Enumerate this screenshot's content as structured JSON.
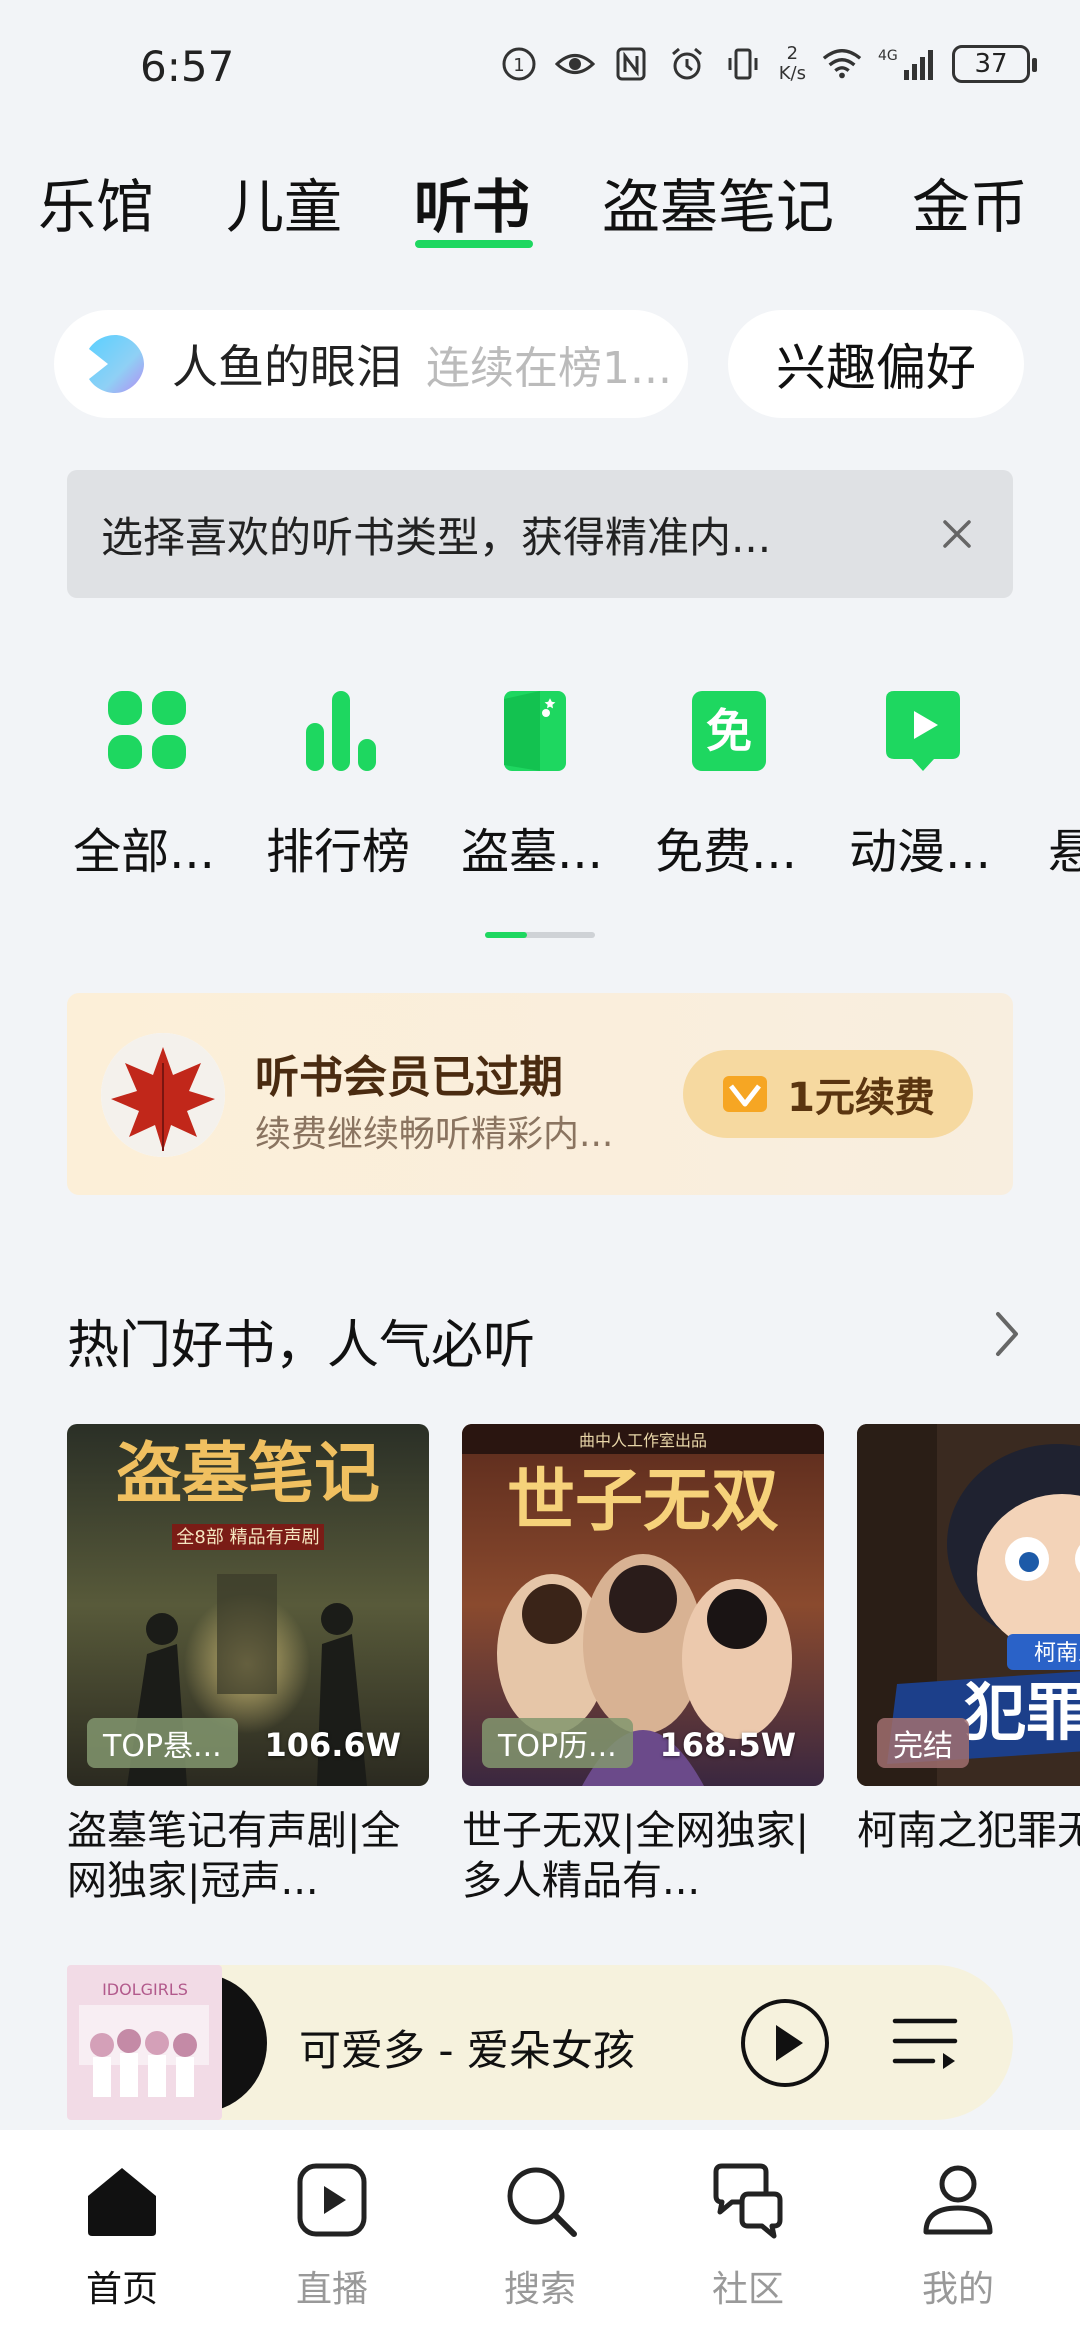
{
  "status_bar": {
    "time": "6:57",
    "net_speed_top": "2",
    "net_speed_bottom": "K/s",
    "network": "4G",
    "battery": "37"
  },
  "top_tabs": [
    {
      "label": "乐馆",
      "active": false
    },
    {
      "label": "儿童",
      "active": false
    },
    {
      "label": "听书",
      "active": true
    },
    {
      "label": "盗墓笔记",
      "active": false
    },
    {
      "label": "金币",
      "active": false
    }
  ],
  "search": {
    "term": "人鱼的眼泪",
    "hint": "连续在榜1..."
  },
  "preference_button": "兴趣偏好",
  "notice": {
    "text": "选择喜欢的听书类型，获得精准内..."
  },
  "categories": [
    {
      "label": "全部...",
      "icon": "grid-icon"
    },
    {
      "label": "排行榜",
      "icon": "bar-chart-icon"
    },
    {
      "label": "盗墓...",
      "icon": "door-icon"
    },
    {
      "label": "免费...",
      "icon": "free-icon"
    },
    {
      "label": "动漫...",
      "icon": "video-icon"
    },
    {
      "label": "悬",
      "icon": "partial-icon"
    }
  ],
  "category_scroll_position": 0.0,
  "vip": {
    "title": "听书会员已过期",
    "subtitle": "续费继续畅听精彩内...",
    "renew_label": "1元续费"
  },
  "hot_section": {
    "title": "热门好书，人气必听"
  },
  "books": [
    {
      "title": "盗墓笔记有声剧|全网独家|冠声...",
      "tag": "TOP悬...",
      "plays": "106.6W",
      "cover_text": "盗墓笔记",
      "cover_sub": "全8部 精品有声剧"
    },
    {
      "title": "世子无双|全网独家|多人精品有...",
      "tag": "TOP历...",
      "plays": "168.5W",
      "cover_text": "世子无双",
      "cover_sub": "曲中人工作室出品"
    },
    {
      "title": "柯南之犯罪无",
      "tag": "完结",
      "plays": "",
      "cover_text": "犯罪无",
      "cover_sub": "柯南之"
    }
  ],
  "player": {
    "song": "可爱多 - 爱朵女孩"
  },
  "bottom_nav": [
    {
      "label": "首页",
      "icon": "home-icon",
      "active": true
    },
    {
      "label": "直播",
      "icon": "live-icon",
      "active": false
    },
    {
      "label": "搜索",
      "icon": "search-icon",
      "active": false
    },
    {
      "label": "社区",
      "icon": "community-icon",
      "active": false
    },
    {
      "label": "我的",
      "icon": "profile-icon",
      "active": false
    }
  ],
  "colors": {
    "accent": "#1ed760",
    "background": "#f2f4f7",
    "vip_bg": "#fcefd8",
    "player_bg": "#f6f2dd"
  }
}
